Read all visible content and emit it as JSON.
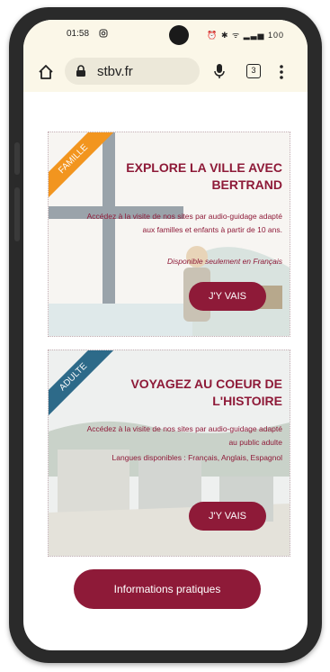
{
  "status_bar": {
    "time": "01:58",
    "icons_text": "⏰ ✱ ᯤ ▂▃▅ 100"
  },
  "browser": {
    "url": "stbv.fr",
    "tab_count": "3"
  },
  "cards": [
    {
      "ribbon": "FAMILLE",
      "ribbon_color": "#f2951f",
      "title_line1": "EXPLORE LA VILLE AVEC",
      "title_line2": "BERTRAND",
      "description": "Accédez à la visite de nos sites par audio-guidage adapté aux familles et enfants à partir de 10 ans.",
      "note": "Disponible seulement en Français",
      "button": "J'Y VAIS"
    },
    {
      "ribbon": "ADULTE",
      "ribbon_color": "#2d6a89",
      "title_line1": "VOYAGEZ AU COEUR DE",
      "title_line2": "L'HISTOIRE",
      "description": "Accédez à la visite de nos sites par audio-guidage adapté au public adulte",
      "note": "Langues disponibles : Français, Anglais, Espagnol",
      "button": "J'Y VAIS"
    }
  ],
  "footer": {
    "info_button": "Informations pratiques"
  },
  "colors": {
    "accent": "#8e1a38",
    "browser_bg": "#fbf7e8"
  }
}
